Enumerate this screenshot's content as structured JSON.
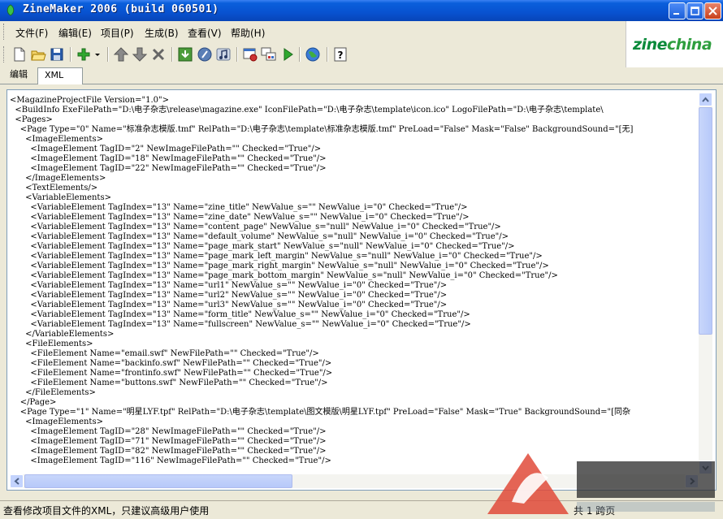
{
  "window": {
    "title": "ZineMaker 2006 (build 060501)"
  },
  "menu": [
    {
      "label": "文件(F)"
    },
    {
      "label": "编辑(E)"
    },
    {
      "label": "项目(P)"
    },
    {
      "label": "生成(B)"
    },
    {
      "label": "查看(V)"
    },
    {
      "label": "帮助(H)"
    }
  ],
  "toolbar": {
    "icons": [
      "new-file-icon",
      "open-folder-icon",
      "save-icon",
      "add-icon",
      "dropdown-arrow-icon",
      "arrow-up-icon",
      "arrow-down-icon",
      "delete-icon",
      "import-icon",
      "help-circle-icon",
      "music-icon",
      "settings-icon",
      "build-icon",
      "play-icon",
      "globe-icon",
      "help-book-icon"
    ]
  },
  "logo": {
    "text_prefix": "zine",
    "text_suffix": "china",
    "color": "#0a8a3a"
  },
  "tabs": [
    {
      "label": "编辑",
      "active": false
    },
    {
      "label": "XML",
      "active": true
    }
  ],
  "editor": {
    "lines": [
      "<MagazineProjectFile Version=\"1.0\">",
      "  <BuildInfo ExeFilePath=\"D:\\电子杂志\\release\\magazine.exe\" IconFilePath=\"D:\\电子杂志\\template\\icon.ico\" LogoFilePath=\"D:\\电子杂志\\template\\",
      "  <Pages>",
      "    <Page Type=\"0\" Name=\"标准杂志模版.tmf\" RelPath=\"D:\\电子杂志\\template\\标准杂志模版.tmf\" PreLoad=\"False\" Mask=\"False\" BackgroundSound=\"[无]",
      "      <ImageElements>",
      "        <ImageElement TagID=\"2\" NewImageFilePath=\"\" Checked=\"True\"/>",
      "        <ImageElement TagID=\"18\" NewImageFilePath=\"\" Checked=\"True\"/>",
      "        <ImageElement TagID=\"22\" NewImageFilePath=\"\" Checked=\"True\"/>",
      "      </ImageElements>",
      "      <TextElements/>",
      "      <VariableElements>",
      "        <VariableElement TagIndex=\"13\" Name=\"zine_title\" NewValue_s=\"\" NewValue_i=\"0\" Checked=\"True\"/>",
      "        <VariableElement TagIndex=\"13\" Name=\"zine_date\" NewValue_s=\"\" NewValue_i=\"0\" Checked=\"True\"/>",
      "        <VariableElement TagIndex=\"13\" Name=\"content_page\" NewValue_s=\"null\" NewValue_i=\"0\" Checked=\"True\"/>",
      "        <VariableElement TagIndex=\"13\" Name=\"default_volume\" NewValue_s=\"null\" NewValue_i=\"0\" Checked=\"True\"/>",
      "        <VariableElement TagIndex=\"13\" Name=\"page_mark_start\" NewValue_s=\"null\" NewValue_i=\"0\" Checked=\"True\"/>",
      "        <VariableElement TagIndex=\"13\" Name=\"page_mark_left_margin\" NewValue_s=\"null\" NewValue_i=\"0\" Checked=\"True\"/>",
      "        <VariableElement TagIndex=\"13\" Name=\"page_mark_right_margin\" NewValue_s=\"null\" NewValue_i=\"0\" Checked=\"True\"/>",
      "        <VariableElement TagIndex=\"13\" Name=\"page_mark_bottom_margin\" NewValue_s=\"null\" NewValue_i=\"0\" Checked=\"True\"/>",
      "        <VariableElement TagIndex=\"13\" Name=\"url1\" NewValue_s=\"\" NewValue_i=\"0\" Checked=\"True\"/>",
      "        <VariableElement TagIndex=\"13\" Name=\"url2\" NewValue_s=\"\" NewValue_i=\"0\" Checked=\"True\"/>",
      "        <VariableElement TagIndex=\"13\" Name=\"url3\" NewValue_s=\"\" NewValue_i=\"0\" Checked=\"True\"/>",
      "        <VariableElement TagIndex=\"13\" Name=\"form_title\" NewValue_s=\"\" NewValue_i=\"0\" Checked=\"True\"/>",
      "        <VariableElement TagIndex=\"13\" Name=\"fullscreen\" NewValue_s=\"\" NewValue_i=\"0\" Checked=\"True\"/>",
      "      </VariableElements>",
      "      <FileElements>",
      "        <FileElement Name=\"email.swf\" NewFilePath=\"\" Checked=\"True\"/>",
      "        <FileElement Name=\"backinfo.swf\" NewFilePath=\"\" Checked=\"True\"/>",
      "        <FileElement Name=\"frontinfo.swf\" NewFilePath=\"\" Checked=\"True\"/>",
      "        <FileElement Name=\"buttons.swf\" NewFilePath=\"\" Checked=\"True\"/>",
      "      </FileElements>",
      "    </Page>",
      "    <Page Type=\"1\" Name=\"明星LYF.tpf\" RelPath=\"D:\\电子杂志\\template\\图文模版\\明星LYF.tpf\" PreLoad=\"False\" Mask=\"True\" BackgroundSound=\"[同杂",
      "      <ImageElements>",
      "        <ImageElement TagID=\"28\" NewImageFilePath=\"\" Checked=\"True\"/>",
      "        <ImageElement TagID=\"71\" NewImageFilePath=\"\" Checked=\"True\"/>",
      "        <ImageElement TagID=\"82\" NewImageFilePath=\"\" Checked=\"True\"/>",
      "        <ImageElement TagID=\"116\" NewImageFilePath=\"\" Checked=\"True\"/>"
    ]
  },
  "status": {
    "message": "查看修改项目文件的XML，只建议高级用户使用",
    "pages": "共 1 跨页"
  }
}
